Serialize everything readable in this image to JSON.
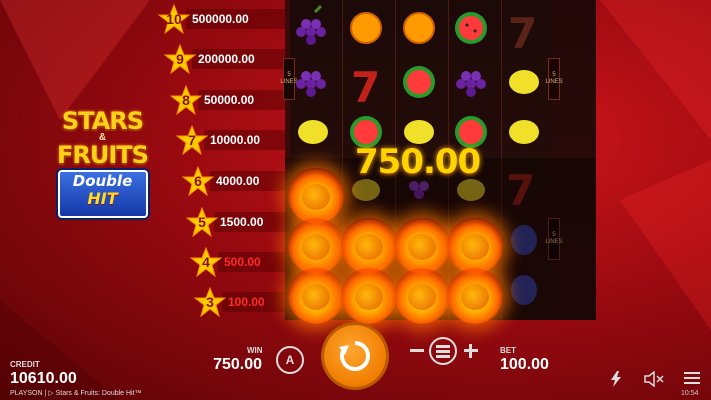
{
  "logo": {
    "line1": "STARS",
    "amp": "&",
    "line2": "FRUITS",
    "badge_line1": "Double",
    "badge_line2": "HIT"
  },
  "paytable": [
    {
      "stars": "10",
      "value": "500000.00",
      "highlight": false
    },
    {
      "stars": "9",
      "value": "200000.00",
      "highlight": false
    },
    {
      "stars": "8",
      "value": "50000.00",
      "highlight": false
    },
    {
      "stars": "7",
      "value": "10000.00",
      "highlight": false
    },
    {
      "stars": "6",
      "value": "4000.00",
      "highlight": false
    },
    {
      "stars": "5",
      "value": "1500.00",
      "highlight": false
    },
    {
      "stars": "4",
      "value": "500.00",
      "highlight": true
    },
    {
      "stars": "3",
      "value": "100.00",
      "highlight": true
    }
  ],
  "reels": {
    "lines_tag": [
      "5",
      "LINES"
    ],
    "win_amount": "750.00"
  },
  "bottom": {
    "credit_label": "CREDIT",
    "credit_value": "10610.00",
    "brand": "PLAYSON | ▷ Stars & Fruits: Double Hit™",
    "win_label": "WIN",
    "win_value": "750.00",
    "bet_label": "BET",
    "bet_value": "100.00",
    "autoplay_icon_letter": "A",
    "clock": "10:54"
  },
  "icons": [
    "autoplay-icon",
    "spin-icon",
    "minus-icon",
    "coin-stack-icon",
    "plus-icon",
    "lightning-icon",
    "sound-off-icon",
    "menu-icon"
  ],
  "colors": {
    "spin_button": "#f07d00",
    "win_amount": "#ffd400",
    "star": "#ffcc00",
    "paytable_highlight": "#ff2a2a"
  }
}
